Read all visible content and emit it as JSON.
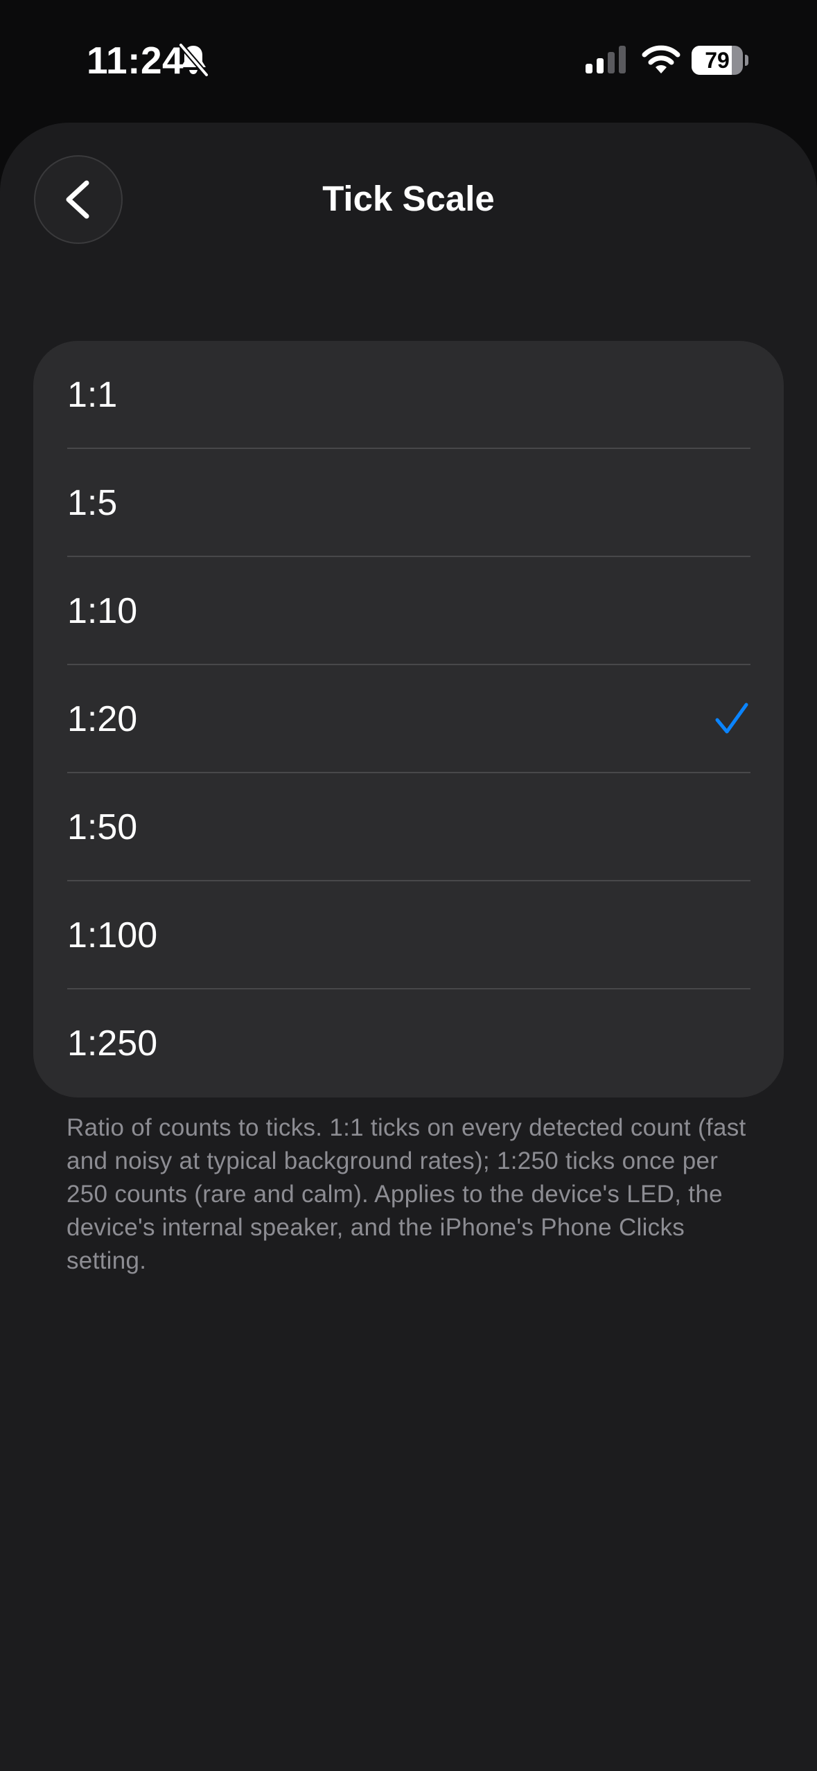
{
  "status_bar": {
    "time": "11:24",
    "battery_percent": "79",
    "battery_level": 0.79,
    "icons": [
      "bell-slash-icon",
      "cellular-signal-icon",
      "wifi-icon",
      "battery-icon"
    ]
  },
  "nav": {
    "title": "Tick Scale",
    "back_icon": "chevron-left-icon"
  },
  "options": [
    {
      "label": "1:1",
      "selected": false
    },
    {
      "label": "1:5",
      "selected": false
    },
    {
      "label": "1:10",
      "selected": false
    },
    {
      "label": "1:20",
      "selected": true
    },
    {
      "label": "1:50",
      "selected": false
    },
    {
      "label": "1:100",
      "selected": false
    },
    {
      "label": "1:250",
      "selected": false
    }
  ],
  "footer": {
    "note": "Ratio of counts to ticks. 1:1 ticks on every detected count (fast and noisy at typical background rates); 1:250 ticks once per 250 counts (rare and calm). Applies to the device's LED, the device's internal speaker, and the iPhone's Phone Clicks setting."
  },
  "colors": {
    "background": "#0b0b0c",
    "sheet": "#1c1c1e",
    "card": "#2c2c2e",
    "accent": "#0a84ff",
    "secondary_text": "#8d8d93"
  }
}
